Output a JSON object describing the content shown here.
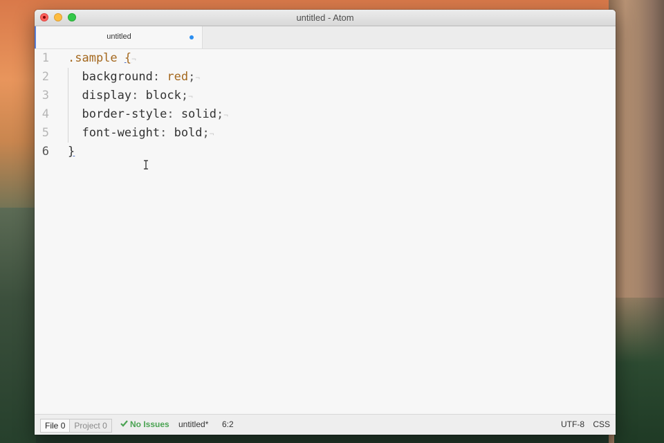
{
  "window": {
    "title": "untitled - Atom"
  },
  "tab": {
    "title": "untitled"
  },
  "editor": {
    "line_numbers": [
      "1",
      "2",
      "3",
      "4",
      "5",
      "6"
    ],
    "current_line": "6",
    "lines": [
      {
        "selector": ".sample",
        "open_brace": "{",
        "eol": "¬"
      },
      {
        "property": "background",
        "colon": ":",
        "value": "red",
        "semi": ";",
        "eol": "¬"
      },
      {
        "property": "display",
        "colon": ":",
        "value": "block",
        "semi": ";",
        "eol": "¬"
      },
      {
        "property": "border-style",
        "colon": ":",
        "value": "solid",
        "semi": ";",
        "eol": "¬"
      },
      {
        "property": "font-weight",
        "colon": ":",
        "value": "bold",
        "semi": ";",
        "eol": "¬"
      },
      {
        "close_brace": "}"
      }
    ]
  },
  "statusbar": {
    "linter_file_label": "File",
    "linter_file_count": "0",
    "linter_project_label": "Project",
    "linter_project_count": "0",
    "issues_label": "No Issues",
    "file_name": "untitled*",
    "cursor_position": "6:2",
    "encoding": "UTF-8",
    "grammar": "CSS"
  },
  "colors": {
    "selector": "#a4681e",
    "value_keyword": "#a4681e",
    "modified_dot": "#2c8ef0",
    "no_issues": "#4aa352"
  }
}
